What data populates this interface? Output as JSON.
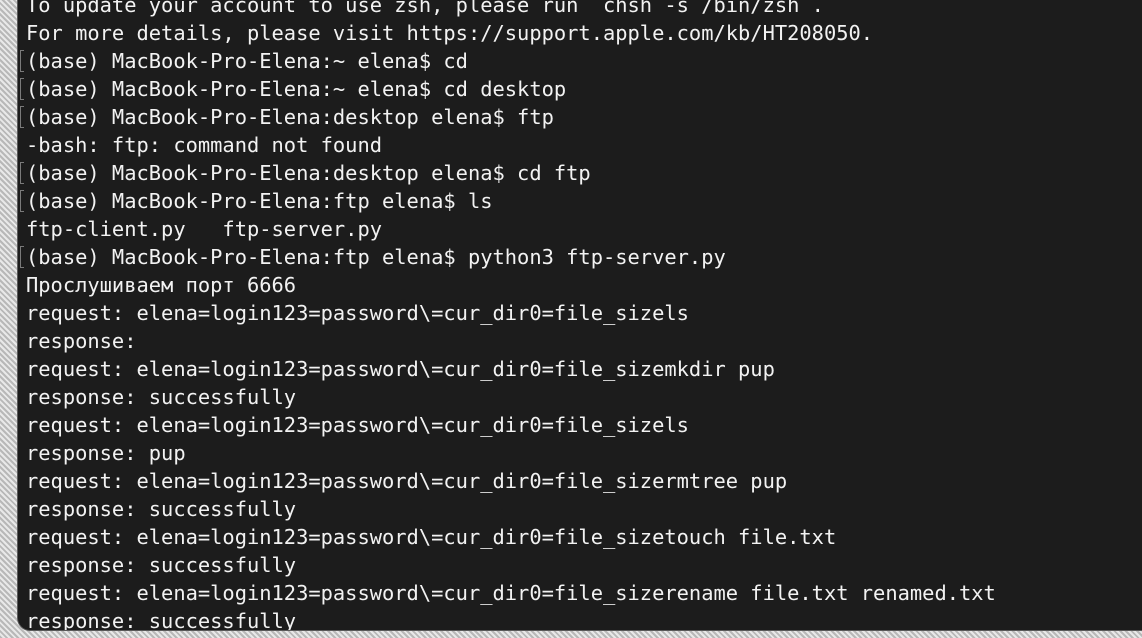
{
  "terminal": {
    "lines": [
      {
        "text": "To update your account to use zsh, please run `chsh -s /bin/zsh`.",
        "mark": false
      },
      {
        "text": "For more details, please visit https://support.apple.com/kb/HT208050.",
        "mark": false
      },
      {
        "text": "(base) MacBook-Pro-Elena:~ elena$ cd",
        "mark": true
      },
      {
        "text": "(base) MacBook-Pro-Elena:~ elena$ cd desktop",
        "mark": true
      },
      {
        "text": "(base) MacBook-Pro-Elena:desktop elena$ ftp",
        "mark": true
      },
      {
        "text": "-bash: ftp: command not found",
        "mark": false
      },
      {
        "text": "(base) MacBook-Pro-Elena:desktop elena$ cd ftp",
        "mark": true
      },
      {
        "text": "(base) MacBook-Pro-Elena:ftp elena$ ls",
        "mark": true
      },
      {
        "text": "ftp-client.py   ftp-server.py",
        "mark": false
      },
      {
        "text": "(base) MacBook-Pro-Elena:ftp elena$ python3 ftp-server.py",
        "mark": true
      },
      {
        "text": "Прослушиваем порт 6666",
        "mark": false
      },
      {
        "text": "request: elena=login123=password\\=cur_dir0=file_sizels",
        "mark": false
      },
      {
        "text": "response:",
        "mark": false
      },
      {
        "text": "request: elena=login123=password\\=cur_dir0=file_sizemkdir pup",
        "mark": false
      },
      {
        "text": "response: successfully",
        "mark": false
      },
      {
        "text": "request: elena=login123=password\\=cur_dir0=file_sizels",
        "mark": false
      },
      {
        "text": "response: pup",
        "mark": false
      },
      {
        "text": "request: elena=login123=password\\=cur_dir0=file_sizermtree pup",
        "mark": false
      },
      {
        "text": "response: successfully",
        "mark": false
      },
      {
        "text": "request: elena=login123=password\\=cur_dir0=file_sizetouch file.txt",
        "mark": false
      },
      {
        "text": "response: successfully",
        "mark": false
      },
      {
        "text": "request: elena=login123=password\\=cur_dir0=file_sizerename file.txt renamed.txt",
        "mark": false
      },
      {
        "text": "response: successfully",
        "mark": false
      }
    ]
  }
}
